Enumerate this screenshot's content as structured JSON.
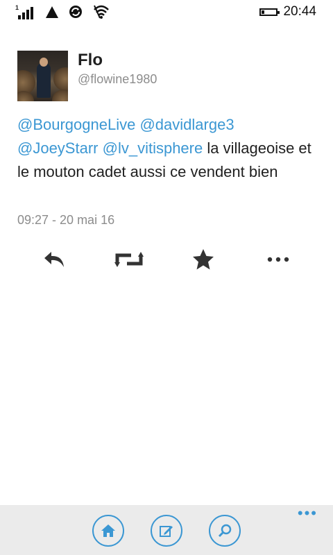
{
  "status_bar": {
    "sim_slot": "1",
    "time": "20:44",
    "icons": [
      "signal-icon",
      "data-triangle-icon",
      "sync-icon",
      "wifi-icon",
      "battery-icon"
    ]
  },
  "tweet": {
    "user_name": "Flo",
    "user_handle": "@flowine1980",
    "mentions": [
      "@BourgogneLive",
      "@davidlarge3",
      "@JoeyStarr",
      "@lv_vitisphere"
    ],
    "body_text": "la villageoise et le mouton cadet aussi ce vendent bien",
    "timestamp": "09:27 - 20 mai 16"
  },
  "actions": [
    "reply-icon",
    "retweet-icon",
    "favorite-icon",
    "more-icon"
  ],
  "app_bar": {
    "buttons": [
      "home-icon",
      "compose-icon",
      "search-icon"
    ],
    "more": "•••"
  },
  "colors": {
    "accent": "#3b97d3",
    "text": "#1f1f1f",
    "muted": "#8c8c8c",
    "app_bar_bg": "#ebebeb"
  }
}
